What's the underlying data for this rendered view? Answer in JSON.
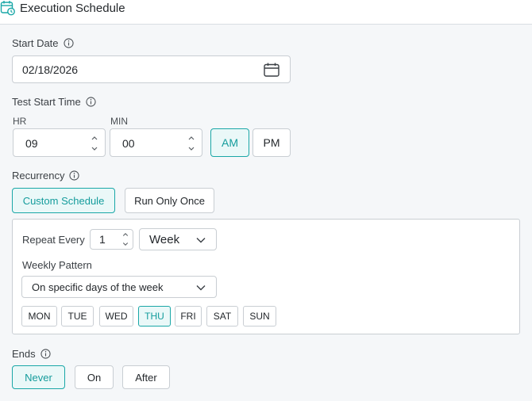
{
  "header": {
    "title": "Execution Schedule",
    "icon": "calendar-clock-icon"
  },
  "start_date": {
    "label": "Start Date",
    "value": "02/18/2026"
  },
  "start_time": {
    "label": "Test Start Time",
    "hour_label": "HR",
    "hour_value": "09",
    "minute_label": "MIN",
    "minute_value": "00",
    "am_label": "AM",
    "pm_label": "PM",
    "selected_period": "AM"
  },
  "recurrency": {
    "label": "Recurrency",
    "custom_label": "Custom Schedule",
    "once_label": "Run Only Once",
    "selected": "Custom Schedule",
    "repeat_every_label": "Repeat Every",
    "repeat_every_value": "1",
    "repeat_unit": "Week",
    "weekly_pattern_label": "Weekly Pattern",
    "weekly_pattern_value": "On specific days of the week",
    "days": [
      "MON",
      "TUE",
      "WED",
      "THU",
      "FRI",
      "SAT",
      "SUN"
    ],
    "selected_days": [
      "THU"
    ]
  },
  "ends": {
    "label": "Ends",
    "never_label": "Never",
    "on_label": "On",
    "after_label": "After",
    "selected": "Never"
  },
  "colors": {
    "accent": "#1aa7a7",
    "accent_bg": "#eaf8f8",
    "border": "#c9ced3",
    "background": "#f5f7f9"
  }
}
